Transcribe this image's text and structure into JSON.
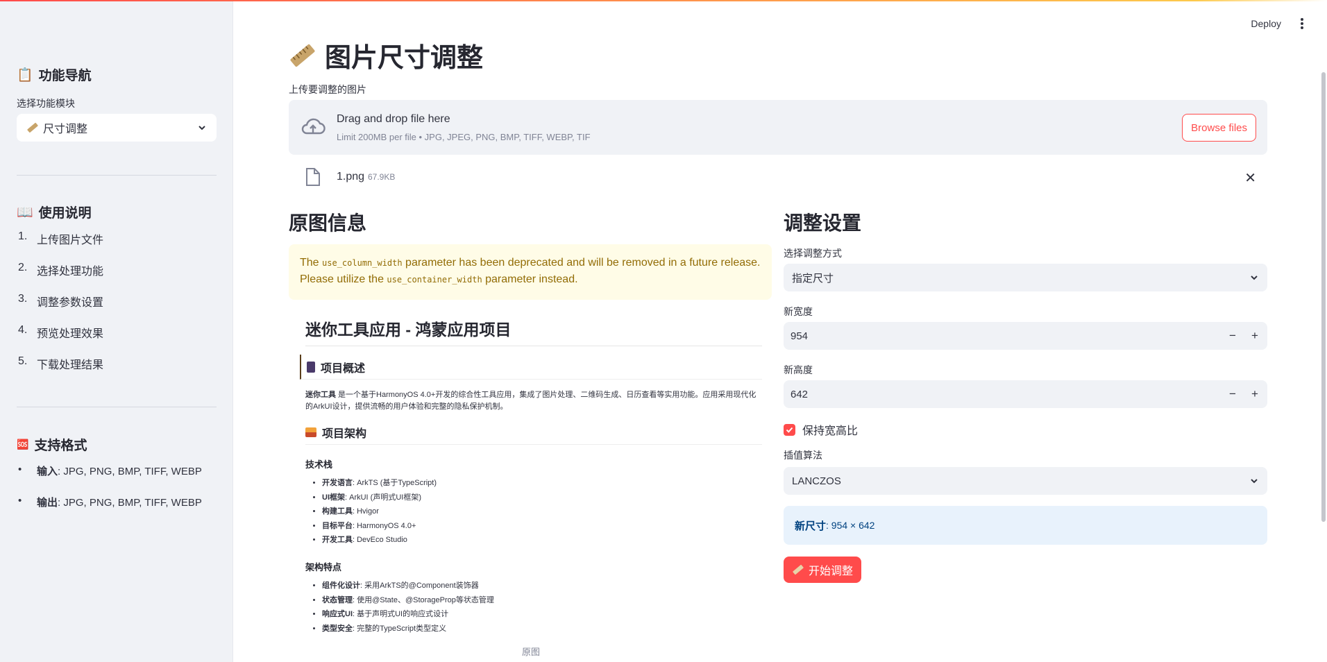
{
  "header": {
    "deploy_label": "Deploy",
    "menu_icon": "kebab-menu-icon"
  },
  "sidebar": {
    "title": "功能导航",
    "title_icon": "📋",
    "select_label": "选择功能模块",
    "select_value": "尺寸调整",
    "select_icon": "ruler-icon",
    "guide_title": "使用说明",
    "guide_icon": "📖",
    "steps": [
      {
        "num": "1.",
        "label": "上传图片文件"
      },
      {
        "num": "2.",
        "label": "选择处理功能"
      },
      {
        "num": "3.",
        "label": "调整参数设置"
      },
      {
        "num": "4.",
        "label": "预览处理效果"
      },
      {
        "num": "5.",
        "label": "下载处理结果"
      }
    ],
    "formats_title": "支持格式",
    "formats_icon": "🆘",
    "formats": [
      {
        "key": "输入",
        "value": ": JPG, PNG, BMP, TIFF, WEBP"
      },
      {
        "key": "输出",
        "value": ": JPG, PNG, BMP, TIFF, WEBP"
      }
    ]
  },
  "main": {
    "title": "图片尺寸调整",
    "upload_label": "上传要调整的图片",
    "dropzone": {
      "main_text": "Drag and drop file here",
      "sub_text": "Limit 200MB per file • JPG, JPEG, PNG, BMP, TIFF, WEBP, TIF",
      "browse_label": "Browse files"
    },
    "file": {
      "name": "1.png",
      "size": "67.9KB"
    },
    "left": {
      "heading": "原图信息",
      "warning": {
        "pre": "The ",
        "code1": "use_column_width",
        "mid": " parameter has been deprecated and will be removed in a future release. Please utilize the ",
        "code2": "use_container_width",
        "post": " parameter instead."
      },
      "doc": {
        "title": "迷你工具应用 - 鸿蒙应用项目",
        "overview_heading": "项目概述",
        "overview_strong": "迷你工具",
        "overview_text": " 是一个基于HarmonyOS 4.0+开发的综合性工具应用，集成了图片处理、二维码生成、日历查看等实用功能。应用采用现代化的ArkUI设计，提供流畅的用户体验和完整的隐私保护机制。",
        "arch_heading": "项目架构",
        "stack_heading": "技术栈",
        "stack": [
          {
            "k": "开发语言",
            "v": ": ArkTS (基于TypeScript)"
          },
          {
            "k": "UI框架",
            "v": ": ArkUI (声明式UI框架)"
          },
          {
            "k": "构建工具",
            "v": ": Hvigor"
          },
          {
            "k": "目标平台",
            "v": ": HarmonyOS 4.0+"
          },
          {
            "k": "开发工具",
            "v": ": DevEco Studio"
          }
        ],
        "features_heading": "架构特点",
        "features": [
          {
            "k": "组件化设计",
            "v": ": 采用ArkTS的@Component装饰器"
          },
          {
            "k": "状态管理",
            "v": ": 使用@State、@StorageProp等状态管理"
          },
          {
            "k": "响应式UI",
            "v": ": 基于声明式UI的响应式设计"
          },
          {
            "k": "类型安全",
            "v": ": 完整的TypeScript类型定义"
          }
        ]
      },
      "caption": "原图"
    },
    "right": {
      "heading": "调整设置",
      "mode_label": "选择调整方式",
      "mode_value": "指定尺寸",
      "width_label": "新宽度",
      "width_value": "954",
      "height_label": "新高度",
      "height_value": "642",
      "minus": "−",
      "plus": "+",
      "keep_ratio_label": "保持宽高比",
      "keep_ratio_checked": true,
      "interp_label": "插值算法",
      "interp_value": "LANCZOS",
      "new_size_label": "新尺寸",
      "new_size_value": ": 954 × 642",
      "start_button": "开始调整"
    }
  },
  "colors": {
    "accent": "#ff4b4b",
    "sidebar_bg": "#f0f2f6",
    "warning_bg": "#fffce7",
    "info_bg": "#e8f2fc"
  }
}
